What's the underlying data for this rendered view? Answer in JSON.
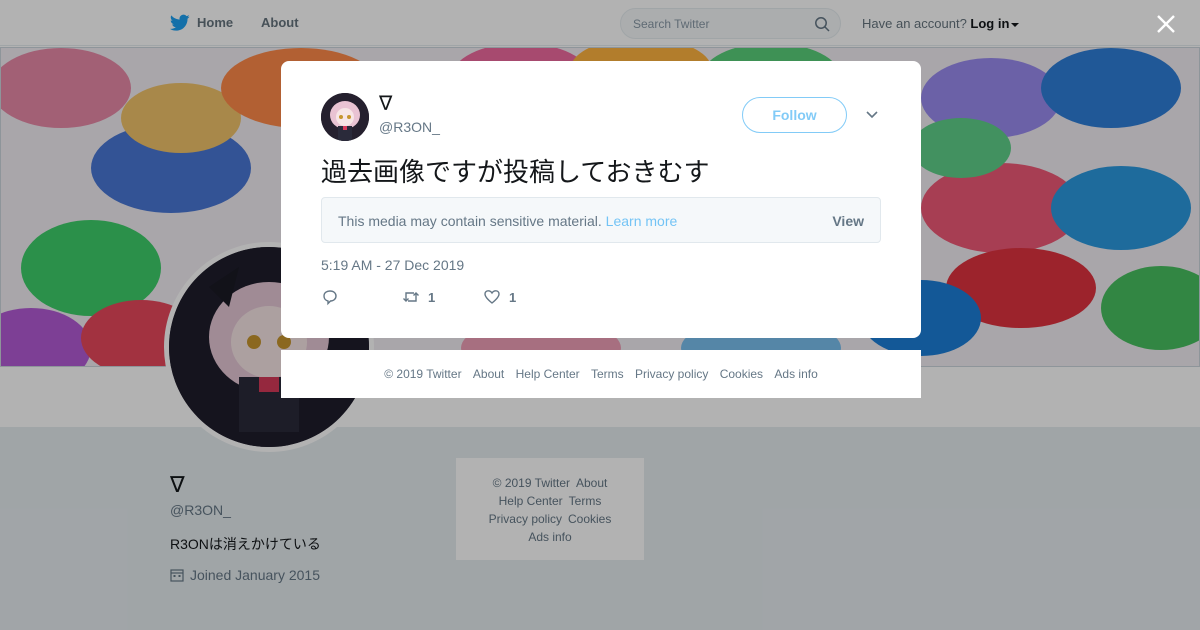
{
  "topnav": {
    "home_label": "Home",
    "about_label": "About",
    "search_placeholder": "Search Twitter",
    "account_prompt": "Have an account?",
    "login_label": "Log in"
  },
  "profile": {
    "name": "∇",
    "handle": "@R3ON_",
    "bio": "R3ONは消えかけている",
    "joined": "Joined January 2015"
  },
  "side_footer": {
    "copyright": "© 2019 Twitter",
    "about": "About",
    "help_center": "Help Center",
    "terms": "Terms",
    "privacy": "Privacy policy",
    "cookies": "Cookies",
    "ads_info": "Ads info"
  },
  "tweet": {
    "name": "∇",
    "handle": "@R3ON_",
    "follow_label": "Follow",
    "text": "過去画像ですが投稿しておきむす",
    "sensitive_notice": "This media may contain sensitive material.",
    "learn_more": "Learn more",
    "view_label": "View",
    "timestamp": "5:19 AM - 27 Dec 2019",
    "retweets": "1",
    "likes": "1"
  },
  "modal_footer": {
    "copyright": "© 2019 Twitter",
    "about": "About",
    "help_center": "Help Center",
    "terms": "Terms",
    "privacy": "Privacy policy",
    "cookies": "Cookies",
    "ads_info": "Ads info"
  },
  "colors": {
    "twitter_blue": "#1da1f2",
    "text_primary": "#14171a",
    "text_secondary": "#657786"
  },
  "icons": [
    "twitter-bird-icon",
    "search-icon",
    "chevron-down-icon",
    "close-icon",
    "calendar-icon",
    "reply-icon",
    "retweet-icon",
    "heart-icon"
  ]
}
